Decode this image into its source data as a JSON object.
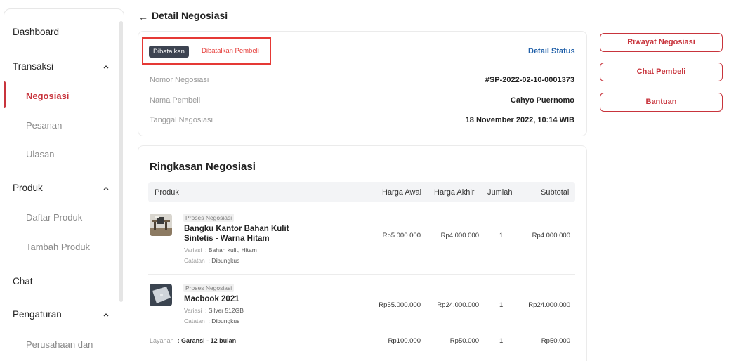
{
  "sidebar": {
    "dashboard": "Dashboard",
    "transaksi": "Transaksi",
    "negosiasi": "Negosiasi",
    "pesanan": "Pesanan",
    "ulasan": "Ulasan",
    "produk": "Produk",
    "daftar_produk": "Daftar Produk",
    "tambah_produk": "Tambah Produk",
    "chat": "Chat",
    "pengaturan": "Pengaturan",
    "perusahaan": "Perusahaan dan"
  },
  "header": {
    "title": "Detail Negosiasi"
  },
  "status": {
    "badge": "Dibatalkan",
    "reason": "Dibatalkan Pembeli",
    "detail_link": "Detail Status"
  },
  "info": {
    "nomor_label": "Nomor Negosiasi",
    "nomor_value": "#SP-2022-02-10-0001373",
    "nama_label": "Nama Pembeli",
    "nama_value": "Cahyo Puernomo",
    "tanggal_label": "Tanggal Negosiasi",
    "tanggal_value": "18 November 2022, 10:14 WIB"
  },
  "summary": {
    "title": "Ringkasan Negosiasi",
    "headers": {
      "produk": "Produk",
      "harga_awal": "Harga Awal",
      "harga_akhir": "Harga Akhir",
      "jumlah": "Jumlah",
      "subtotal": "Subtotal"
    },
    "rows": [
      {
        "chip": "Proses Negosiasi",
        "name": "Bangku Kantor Bahan Kulit Sintetis - Warna Hitam",
        "variasi_label": "Variasi",
        "variasi": ": Bahan kulit, Hitam",
        "catatan_label": "Catatan",
        "catatan": ": Dibungkus",
        "harga_awal": "Rp5.000.000",
        "harga_akhir": "Rp4.000.000",
        "jumlah": "1",
        "subtotal": "Rp4.000.000"
      },
      {
        "chip": "Proses Negosiasi",
        "name": "Macbook 2021",
        "variasi_label": "Variasi",
        "variasi": ": Silver 512GB",
        "catatan_label": "Catatan",
        "catatan": ": Dibungkus",
        "harga_awal": "Rp55.000.000",
        "harga_akhir": "Rp24.000.000",
        "jumlah": "1",
        "subtotal": "Rp24.000.000"
      }
    ],
    "layanan": {
      "label": "Layanan",
      "value": ": Garansi - 12 bulan",
      "harga_awal": "Rp100.000",
      "harga_akhir": "Rp50.000",
      "jumlah": "1",
      "subtotal": "Rp50.000"
    }
  },
  "actions": {
    "riwayat": "Riwayat Negosiasi",
    "chat": "Chat Pembeli",
    "bantuan": "Bantuan"
  },
  "colors": {
    "accent": "#c8343c",
    "link": "#1f5fa8",
    "badge_dark": "#3d4451"
  }
}
